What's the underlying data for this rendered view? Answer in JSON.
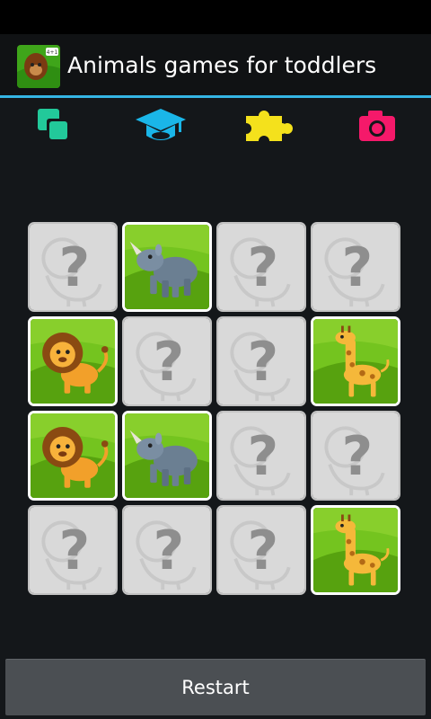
{
  "app": {
    "title": "Animals games for toddlers"
  },
  "tabs": [
    {
      "icon": "squares-icon",
      "color": "#22c99a"
    },
    {
      "icon": "graduation-cap-icon",
      "color": "#1ab6e8"
    },
    {
      "icon": "puzzle-icon",
      "color": "#f4e11c"
    },
    {
      "icon": "camera-icon",
      "color": "#f5196a"
    }
  ],
  "board": {
    "rows": 4,
    "cols": 4,
    "cards": [
      "hidden",
      "rhino",
      "hidden",
      "hidden",
      "lion",
      "hidden",
      "hidden",
      "giraffe",
      "lion",
      "rhino",
      "hidden",
      "hidden",
      "hidden",
      "hidden",
      "hidden",
      "giraffe"
    ]
  },
  "colors": {
    "accent": "#35b5e5",
    "card_green": "#6cc01c",
    "hidden_card": "#d9d9d9"
  },
  "footer": {
    "restart_label": "Restart"
  }
}
